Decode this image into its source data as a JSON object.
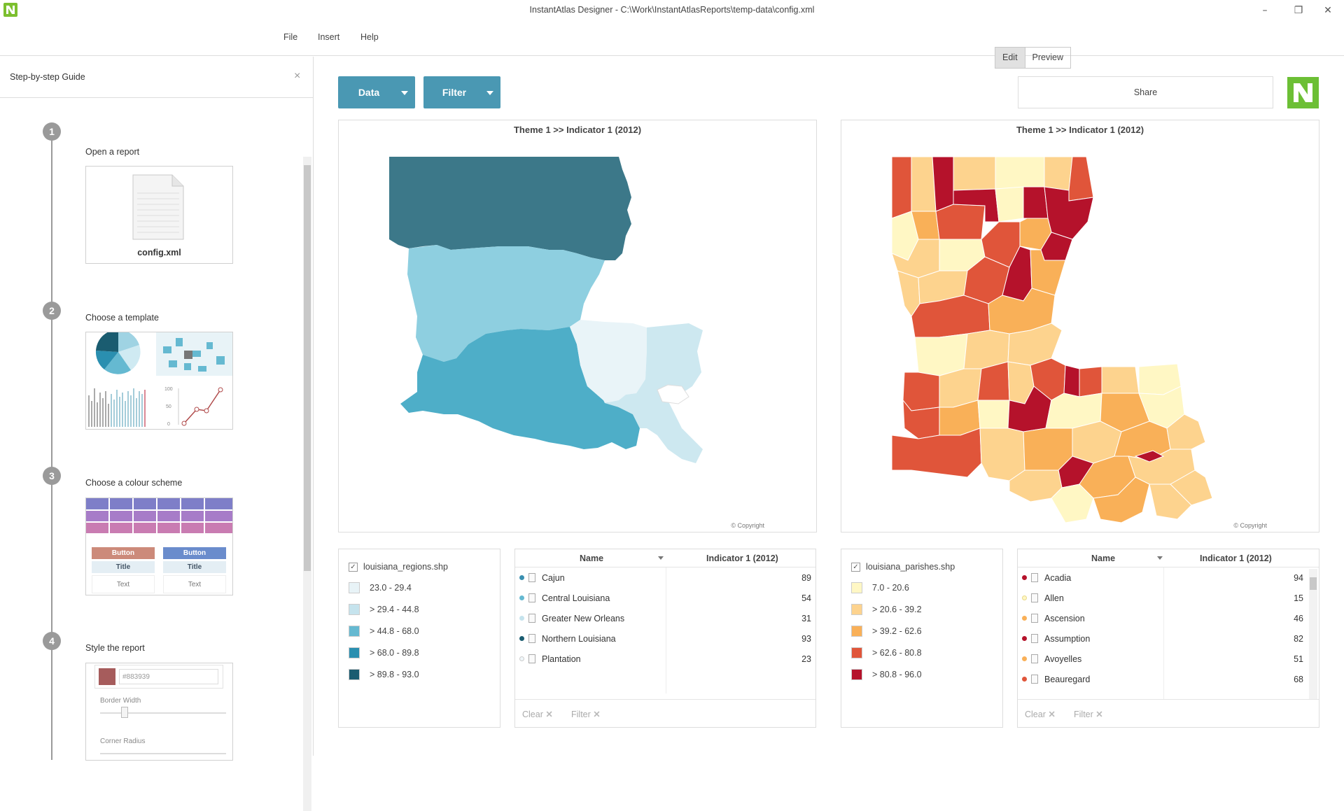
{
  "window": {
    "title": "InstantAtlas Designer - C:\\Work\\InstantAtlasReports\\temp-data\\config.xml",
    "minimize": "–",
    "restore": "❐",
    "close": "✕"
  },
  "menu": {
    "items": [
      "File",
      "Insert",
      "Help"
    ]
  },
  "mode": {
    "edit": "Edit",
    "preview": "Preview"
  },
  "guide": {
    "title": "Step-by-step Guide",
    "close": "×",
    "steps": [
      {
        "num": "1",
        "label": "Open a report",
        "file_name": "config.xml"
      },
      {
        "num": "2",
        "label": "Choose a template",
        "axis_100": "100",
        "axis_50": "50",
        "axis_0": "0"
      },
      {
        "num": "3",
        "label": "Choose a colour scheme",
        "button": "Button",
        "title": "Title",
        "text": "Text"
      },
      {
        "num": "4",
        "label": "Style the report",
        "color_value": "#883939",
        "border_width": "Border Width",
        "corner_radius": "Corner Radius"
      }
    ]
  },
  "toolbar": {
    "data_label": "Data",
    "filter_label": "Filter",
    "share_label": "Share"
  },
  "colors": {
    "accent": "#4a98b3",
    "brand": "#6cbf35",
    "swatch_brand": "#a65c5c"
  },
  "map_left": {
    "title": "Theme 1 >>  Indicator 1 (2012)",
    "copyright": "© Copyright"
  },
  "map_right": {
    "title": "Theme 1 >>  Indicator 1 (2012)",
    "copyright": "© Copyright"
  },
  "legend_left": {
    "layer": "louisiana_regions.shp",
    "classes": [
      {
        "label": "23.0 - 29.4",
        "color": "#e8f3f7"
      },
      {
        "label": "> 29.4 - 44.8",
        "color": "#c5e3ed"
      },
      {
        "label": "> 44.8 - 68.0",
        "color": "#65b9d1"
      },
      {
        "label": "> 68.0 - 89.8",
        "color": "#2a8fb0"
      },
      {
        "label": "> 89.8 - 93.0",
        "color": "#1a5c70"
      }
    ]
  },
  "legend_right": {
    "layer": "louisiana_parishes.shp",
    "classes": [
      {
        "label": "7.0 - 20.6",
        "color": "#fff7c4"
      },
      {
        "label": "> 20.6 - 39.2",
        "color": "#fdd38e"
      },
      {
        "label": "> 39.2 - 62.6",
        "color": "#f9b058"
      },
      {
        "label": "> 62.6 - 80.8",
        "color": "#e0553a"
      },
      {
        "label": "> 80.8 - 96.0",
        "color": "#b5122b"
      }
    ]
  },
  "table_left": {
    "col_name": "Name",
    "col_value": "Indicator 1 (2012)",
    "rows": [
      {
        "name": "Cajun",
        "value": "89",
        "color": "#3a8fb0"
      },
      {
        "name": "Central Louisiana",
        "value": "54",
        "color": "#65b9d1"
      },
      {
        "name": "Greater New Orleans",
        "value": "31",
        "color": "#c5e3ed"
      },
      {
        "name": "Northern Louisiana",
        "value": "93",
        "color": "#1a5c70"
      },
      {
        "name": "Plantation",
        "value": "23",
        "color": "#e8f3f7"
      }
    ],
    "clear": "Clear",
    "filter": "Filter"
  },
  "table_right": {
    "col_name": "Name",
    "col_value": "Indicator 1 (2012)",
    "rows": [
      {
        "name": "Acadia",
        "value": "94",
        "color": "#b5122b"
      },
      {
        "name": "Allen",
        "value": "15",
        "color": "#fff7c4"
      },
      {
        "name": "Ascension",
        "value": "46",
        "color": "#f9b058"
      },
      {
        "name": "Assumption",
        "value": "82",
        "color": "#b5122b"
      },
      {
        "name": "Avoyelles",
        "value": "51",
        "color": "#f9b058"
      },
      {
        "name": "Beauregard",
        "value": "68",
        "color": "#e0553a"
      }
    ],
    "clear": "Clear",
    "filter": "Filter"
  }
}
